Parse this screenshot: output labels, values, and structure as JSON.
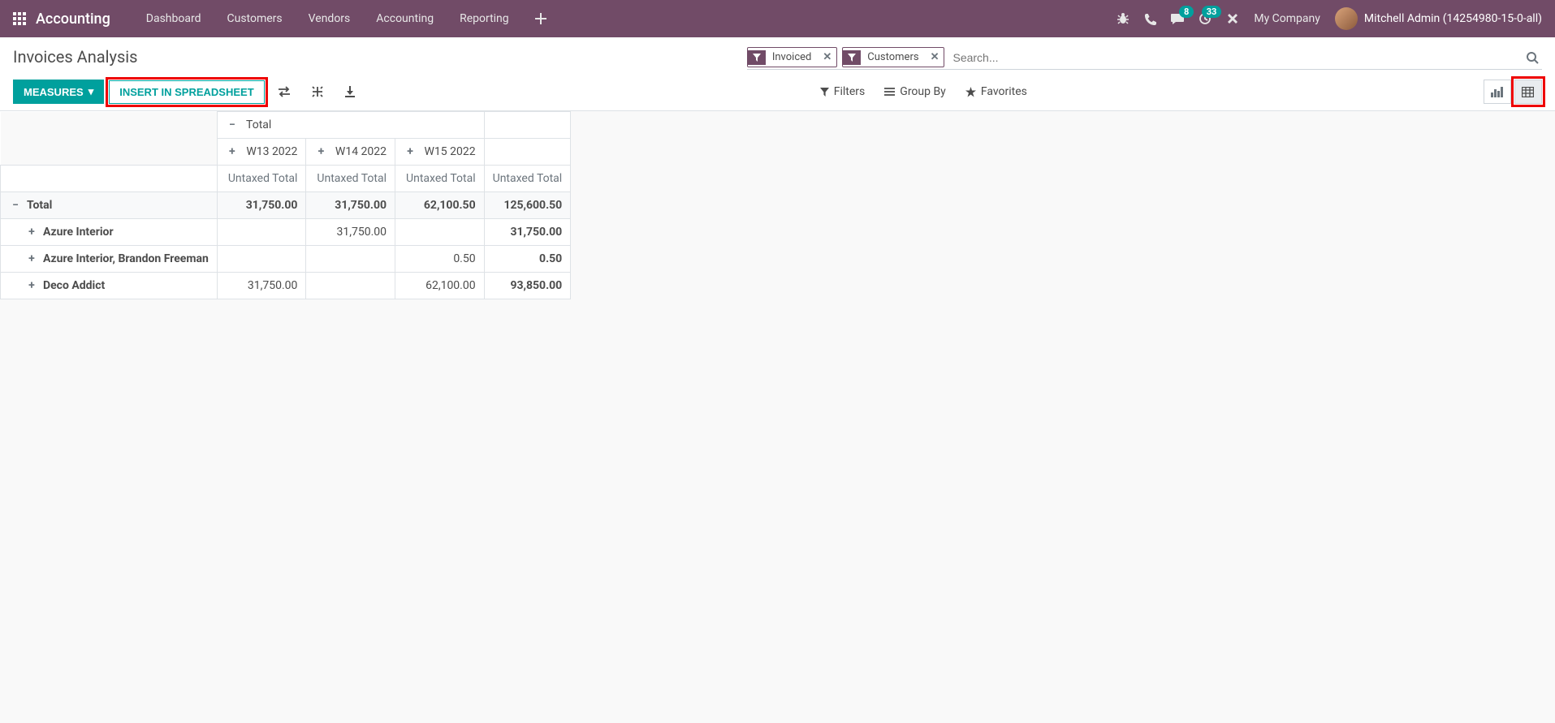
{
  "navbar": {
    "brand": "Accounting",
    "menu": [
      "Dashboard",
      "Customers",
      "Vendors",
      "Accounting",
      "Reporting"
    ],
    "messaging_badge": "8",
    "activities_badge": "33",
    "company": "My Company",
    "user": "Mitchell Admin (14254980-15-0-all)"
  },
  "breadcrumb": "Invoices Analysis",
  "search": {
    "facets": [
      {
        "label": "Invoiced"
      },
      {
        "label": "Customers"
      }
    ],
    "placeholder": "Search..."
  },
  "toolbar": {
    "measures": "Measures",
    "insert_spreadsheet": "Insert in Spreadsheet",
    "filters": "Filters",
    "groupby": "Group By",
    "favorites": "Favorites"
  },
  "pivot": {
    "total_label": "Total",
    "columns": [
      "W13 2022",
      "W14 2022",
      "W15 2022"
    ],
    "measure": "Untaxed Total",
    "rows": [
      {
        "label": "Total",
        "level": 0,
        "expanded": true,
        "vals": [
          "31,750.00",
          "31,750.00",
          "62,100.50"
        ],
        "total": "125,600.50",
        "bold": true
      },
      {
        "label": "Azure Interior",
        "level": 1,
        "expanded": false,
        "vals": [
          "",
          "31,750.00",
          ""
        ],
        "total": "31,750.00"
      },
      {
        "label": "Azure Interior, Brandon Freeman",
        "level": 1,
        "expanded": false,
        "vals": [
          "",
          "",
          "0.50"
        ],
        "total": "0.50"
      },
      {
        "label": "Deco Addict",
        "level": 1,
        "expanded": false,
        "vals": [
          "31,750.00",
          "",
          "62,100.00"
        ],
        "total": "93,850.00"
      }
    ]
  }
}
